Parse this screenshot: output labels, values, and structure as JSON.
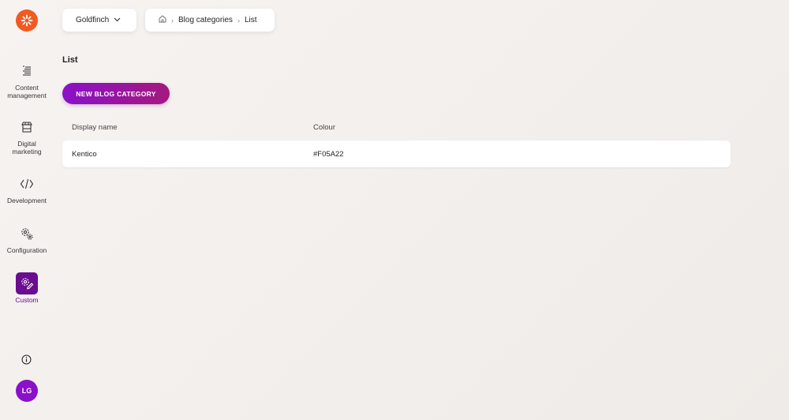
{
  "sidebar": {
    "logo": "kentico-logo",
    "items": [
      {
        "label": "Content management",
        "icon": "content-list-icon"
      },
      {
        "label": "Digital marketing",
        "icon": "storefront-icon"
      },
      {
        "label": "Development",
        "icon": "code-icon"
      },
      {
        "label": "Configuration",
        "icon": "gears-icon"
      },
      {
        "label": "Custom",
        "icon": "custom-gear-pencil-icon",
        "active": true
      }
    ],
    "info_icon": "info-icon",
    "avatar_initials": "LG"
  },
  "header": {
    "site_selector": "Goldfinch",
    "breadcrumb": [
      "Blog categories",
      "List"
    ]
  },
  "main": {
    "title": "List",
    "new_button": "NEW BLOG CATEGORY",
    "table": {
      "columns": [
        "Display name",
        "Colour"
      ],
      "rows": [
        [
          "Kentico",
          "#F05A22"
        ]
      ]
    }
  },
  "colors": {
    "brand": "#F05A22",
    "accent": "#8A10C9",
    "active_nav": "#6A0D8F"
  }
}
